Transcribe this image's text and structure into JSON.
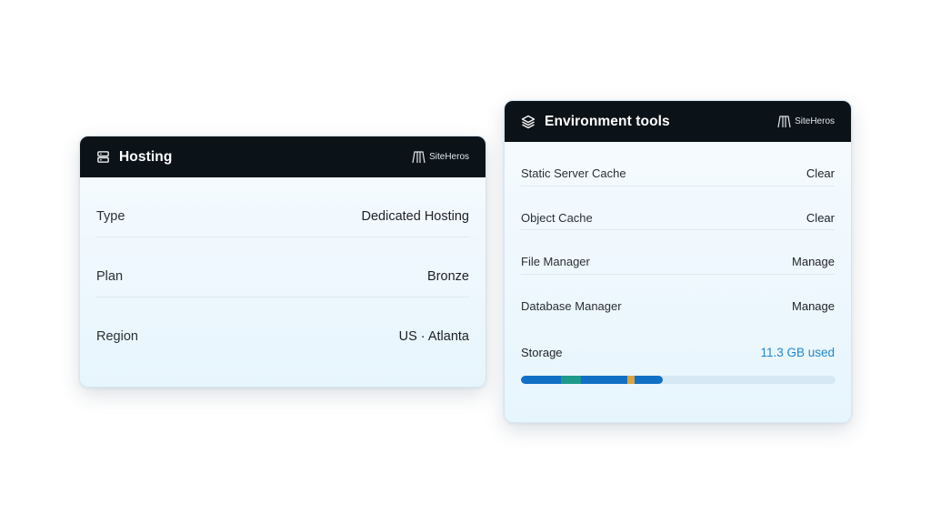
{
  "hosting": {
    "title": "Hosting",
    "brand": "SiteHeros",
    "icon": "server-icon",
    "rows": [
      {
        "label": "Type",
        "value": "Dedicated Hosting"
      },
      {
        "label": "Plan",
        "value": "Bronze"
      },
      {
        "label": "Region",
        "value": "US · Atlanta"
      }
    ]
  },
  "env": {
    "title": "Environment tools",
    "brand": "SiteHeros",
    "icon": "layers-icon",
    "tools": [
      {
        "label": "Static Server Cache",
        "action": "Clear"
      },
      {
        "label": "Object Cache",
        "action": "Clear"
      },
      {
        "label": "File Manager",
        "action": "Manage"
      },
      {
        "label": "Database Manager",
        "action": "Manage"
      }
    ],
    "storage": {
      "label": "Storage",
      "used": "11.3 GB used",
      "used_fraction": 0.45,
      "segments": [
        {
          "start": 0.128,
          "end": 0.19,
          "color": "#1d9a8a"
        },
        {
          "start": 0.337,
          "end": 0.36,
          "color": "#d9a441"
        }
      ]
    }
  },
  "colors": {
    "header_bg": "#0b1319",
    "accent": "#1f86cf",
    "bar_fill": "#1170c6",
    "bar_track": "#d6e8f4"
  }
}
